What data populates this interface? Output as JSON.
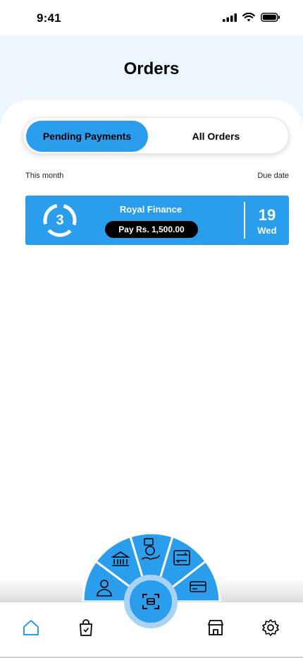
{
  "status_bar": {
    "time": "9:41"
  },
  "header": {
    "title": "Orders"
  },
  "tabs": {
    "pending": "Pending Payments",
    "all": "All Orders"
  },
  "labels": {
    "this_month": "This month",
    "due_date": "Due date"
  },
  "payment_card": {
    "count": "3",
    "company": "Royal Finance",
    "pay_label": "Pay Rs. 1,500.00",
    "day": "19",
    "weekday": "Wed"
  },
  "colors": {
    "accent": "#2a9ded",
    "accent_light": "#a8d3f3",
    "header_bg": "#eef6fd"
  },
  "radial_menu": {
    "items": [
      "user-icon",
      "bank-icon",
      "money-hand-icon",
      "exchange-icon",
      "card-icon"
    ]
  },
  "bottom_nav": {
    "items": [
      "home-icon",
      "shopping-bag-icon",
      "scan-icon",
      "store-icon",
      "settings-icon"
    ],
    "active": "home-icon"
  }
}
